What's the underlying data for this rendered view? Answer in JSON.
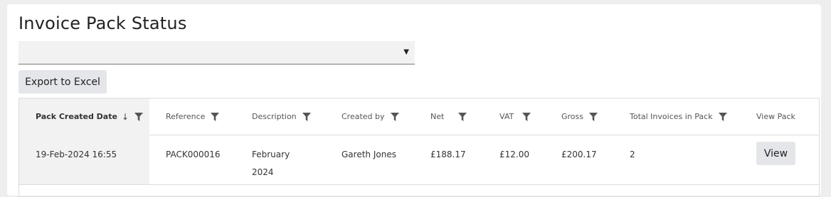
{
  "page": {
    "title": "Invoice Pack Status",
    "select_value": "",
    "export_label": "Export to Excel"
  },
  "table": {
    "columns": [
      {
        "label": "Pack Created Date",
        "sort": "↓",
        "filter": true
      },
      {
        "label": "Reference",
        "filter": true
      },
      {
        "label": "Description",
        "filter": true
      },
      {
        "label": "Created by",
        "filter": true
      },
      {
        "label": "Net",
        "filter": true
      },
      {
        "label": "VAT",
        "filter": true
      },
      {
        "label": "Gross",
        "filter": true
      },
      {
        "label": "Total Invoices in Pack",
        "filter": true
      },
      {
        "label": "View Pack",
        "filter": false
      }
    ],
    "rows": [
      {
        "date": "19-Feb-2024 16:55",
        "reference": "PACK000016",
        "description_line1": "February",
        "description_line2": "2024",
        "created_by": "Gareth Jones",
        "net": "£188.17",
        "vat": "£12.00",
        "gross": "£200.17",
        "total_invoices": "2",
        "view_label": "View"
      }
    ]
  },
  "icons": {
    "filter": "filter-icon",
    "sort": "arrow-down-icon",
    "dropdown": "caret-down-icon"
  }
}
